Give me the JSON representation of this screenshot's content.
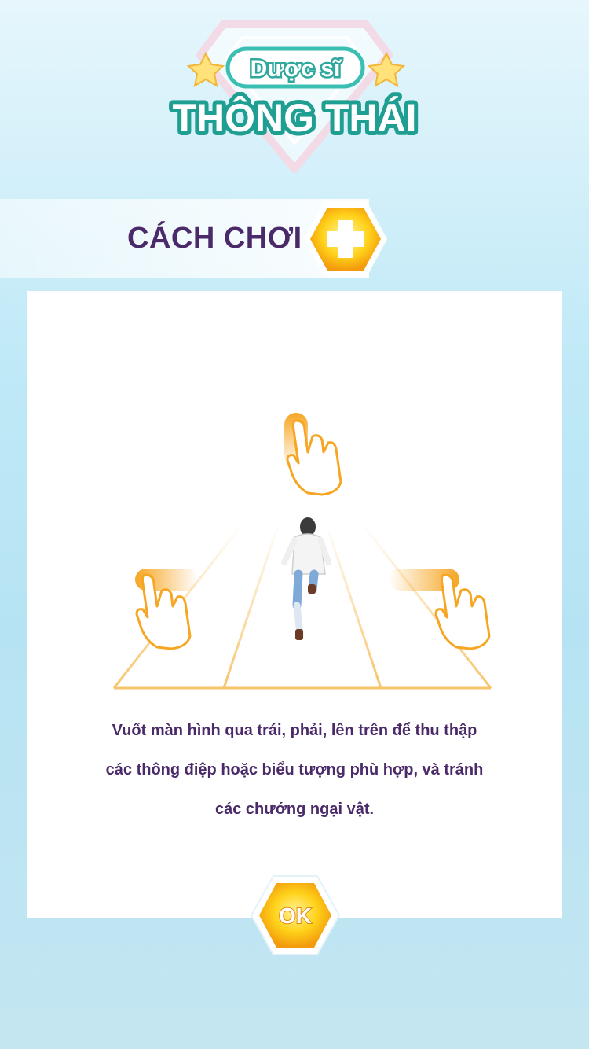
{
  "logo": {
    "line1": "Dược sĩ",
    "line2": "THÔNG THÁI"
  },
  "section": {
    "title": "CÁCH CHƠI",
    "icon": "dpad-icon"
  },
  "instructions": {
    "line1": "Vuốt màn hình qua trái, phải, lên trên để thu thập",
    "line2": "các thông điệp hoặc biểu tượng phù hợp, và tránh",
    "line3": "các chướng ngại vật."
  },
  "ok_button": {
    "label": "OK"
  },
  "colors": {
    "title_purple": "#4a2a68",
    "accent_orange": "#f6a623",
    "accent_yellow": "#ffd84a",
    "logo_teal": "#3bbfb3"
  }
}
